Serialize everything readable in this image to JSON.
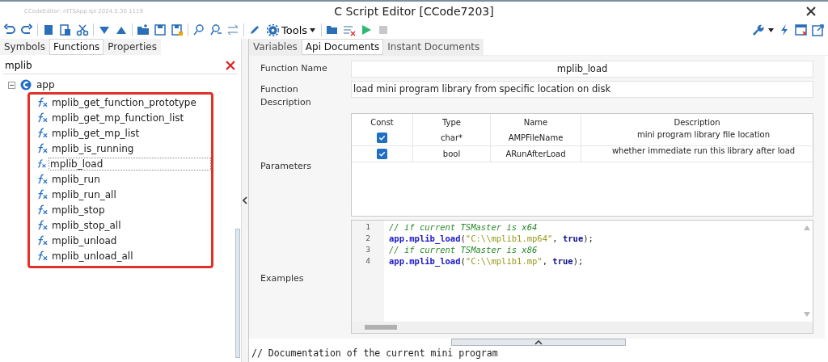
{
  "window": {
    "caption": "CCodeEditor: ntTSApp.tpl 2024.5.30 1119",
    "title": "C Script Editor [CCode7203]"
  },
  "toolbar": {
    "tools_label": "Tools"
  },
  "left_tabs": [
    {
      "label": "Symbols",
      "selected": false
    },
    {
      "label": "Functions",
      "selected": true
    },
    {
      "label": "Properties",
      "selected": false
    }
  ],
  "search": {
    "value": "mplib"
  },
  "tree": {
    "label": "app",
    "expanded": true,
    "children": [
      {
        "label": "mplib_get_function_prototype",
        "selected": false
      },
      {
        "label": "mplib_get_mp_function_list",
        "selected": false
      },
      {
        "label": "mplib_get_mp_list",
        "selected": false
      },
      {
        "label": "mplib_is_running",
        "selected": false
      },
      {
        "label": "mplib_load",
        "selected": true
      },
      {
        "label": "mplib_run",
        "selected": false
      },
      {
        "label": "mplib_run_all",
        "selected": false
      },
      {
        "label": "mplib_stop",
        "selected": false
      },
      {
        "label": "mplib_stop_all",
        "selected": false
      },
      {
        "label": "mplib_unload",
        "selected": false
      },
      {
        "label": "mplib_unload_all",
        "selected": false
      }
    ]
  },
  "right_tabs": [
    {
      "label": "Variables",
      "selected": false
    },
    {
      "label": "Api Documents",
      "selected": true
    },
    {
      "label": "Instant Documents",
      "selected": false
    }
  ],
  "doc": {
    "name_label": "Function Name",
    "name": "mplib_load",
    "desc_label": "Function Description",
    "description": "load mini program library from specific location on disk",
    "params_label": "Parameters",
    "param_columns": [
      "Const",
      "Type",
      "Name",
      "Description"
    ],
    "params": [
      {
        "const": true,
        "type": "char*",
        "name": "AMPFileName",
        "description": "mini program library file location"
      },
      {
        "const": true,
        "type": "bool",
        "name": "ARunAfterLoad",
        "description": "whether immediate run this library after load"
      }
    ],
    "examples_label": "Examples",
    "code": [
      {
        "number": "1",
        "tokens": [
          {
            "kind": "comment",
            "text": "// if current TSMaster is x64"
          }
        ]
      },
      {
        "number": "2",
        "tokens": [
          {
            "kind": "call",
            "text": "app.mplib_load"
          },
          {
            "kind": "plain",
            "text": "("
          },
          {
            "kind": "string",
            "text": "\"C:\\\\mplib1.mp64\""
          },
          {
            "kind": "plain",
            "text": ", "
          },
          {
            "kind": "keyword",
            "text": "true"
          },
          {
            "kind": "plain",
            "text": ");"
          }
        ]
      },
      {
        "number": "3",
        "tokens": [
          {
            "kind": "comment",
            "text": "// if current TSMaster is x86"
          }
        ]
      },
      {
        "number": "4",
        "tokens": [
          {
            "kind": "call",
            "text": "app.mplib_load"
          },
          {
            "kind": "plain",
            "text": "("
          },
          {
            "kind": "string",
            "text": "\"C:\\\\mplib1.mp\""
          },
          {
            "kind": "plain",
            "text": ", "
          },
          {
            "kind": "keyword",
            "text": "true"
          },
          {
            "kind": "plain",
            "text": ");"
          }
        ]
      }
    ]
  },
  "editor_line": "// Documentation of the current mini program"
}
